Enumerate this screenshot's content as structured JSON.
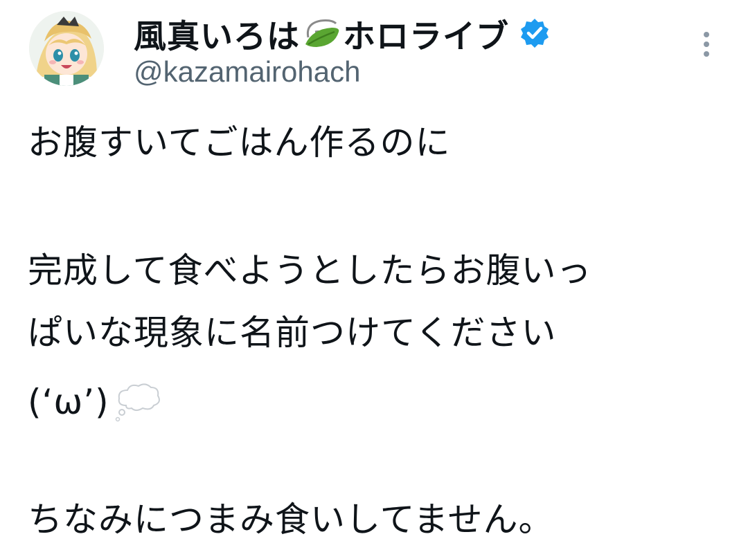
{
  "tweet": {
    "author": {
      "name_prefix": "風真いろは",
      "name_suffix": "ホロライブ",
      "name_emoji": "leaf-emoji",
      "verified_icon": "verified-badge-icon",
      "handle": "@kazamairohach"
    },
    "menu_icon": "more-vertical-icon",
    "text_lines": [
      "お腹すいてごはん作るのに",
      "完成して食べようとしたらお腹いっ",
      "ぱいな現象に名前つけてください",
      "(‘ω’)",
      "ちなみにつまみ食いしてません。"
    ],
    "line4_emoji": "thought-balloon-emoji",
    "colors": {
      "text": "#0f1419",
      "handle": "#536471",
      "verified": "#1d9bf0",
      "leaf": "#5aa632"
    }
  }
}
